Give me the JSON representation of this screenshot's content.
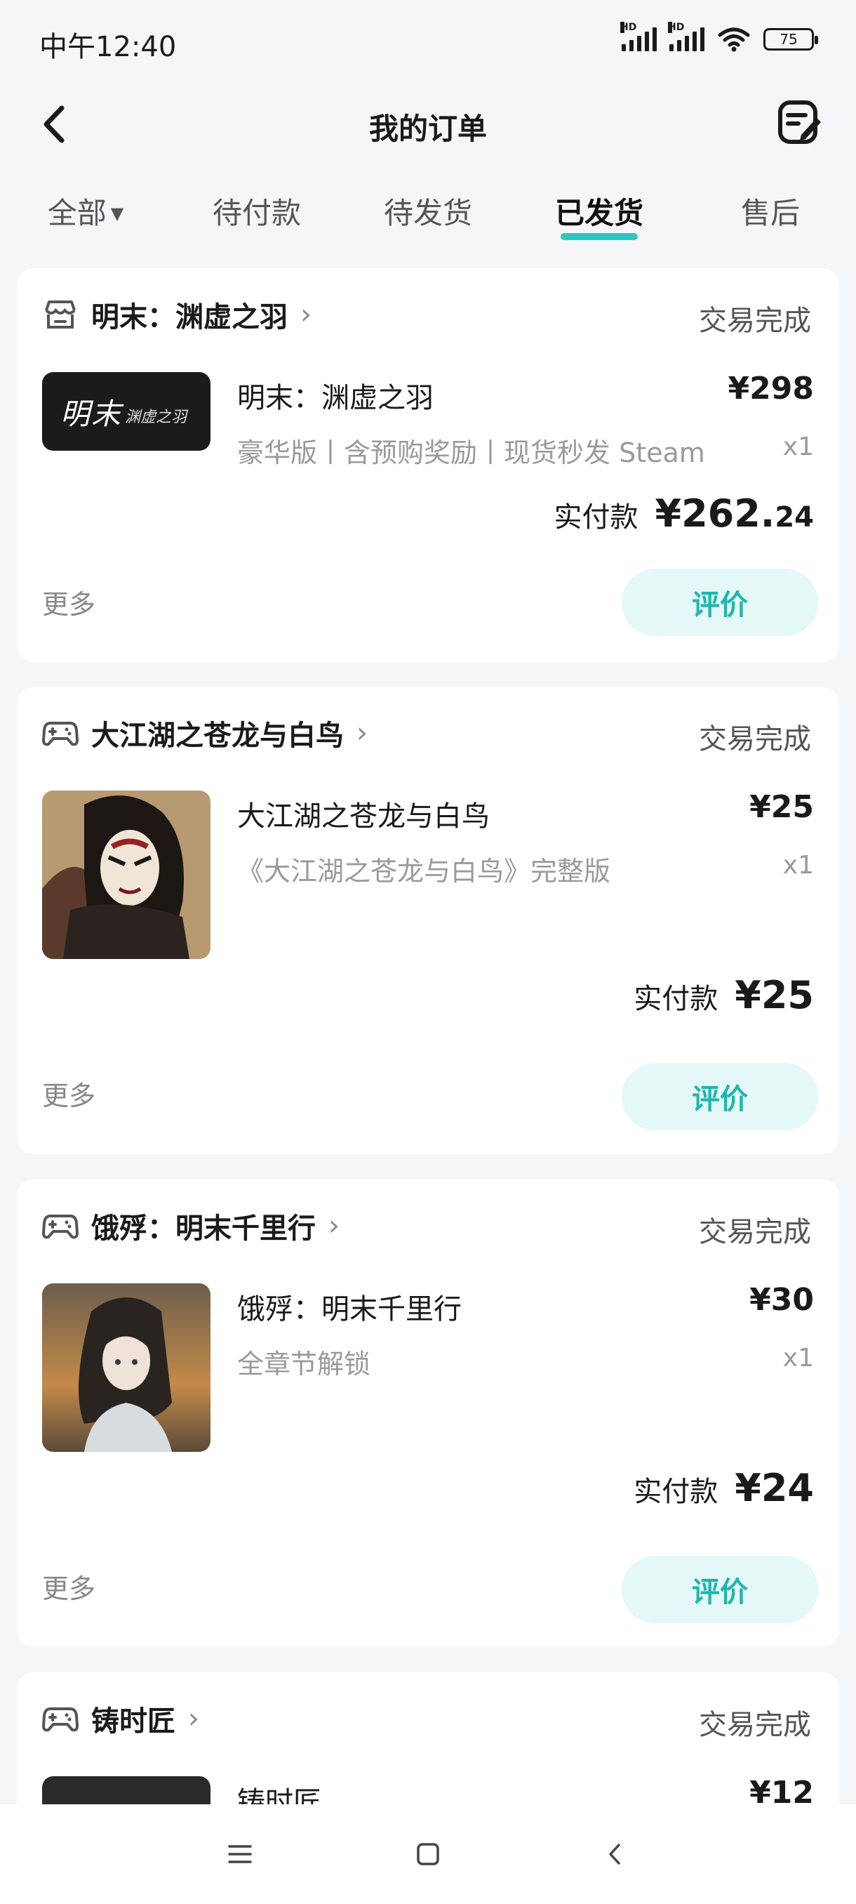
{
  "status_bar": {
    "time": "中午12:40",
    "battery": "75"
  },
  "header": {
    "title": "我的订单"
  },
  "tabs": [
    {
      "label": "全部",
      "has_caret": true
    },
    {
      "label": "待付款"
    },
    {
      "label": "待发货"
    },
    {
      "label": "已发货",
      "active": true
    },
    {
      "label": "售后"
    }
  ],
  "orders": [
    {
      "shop": "明末：渊虚之羽",
      "status": "交易完成",
      "product": "明末：渊虚之羽",
      "price": "¥298",
      "spec": "豪华版丨含预购奖励丨现货秒发 Steam",
      "qty": "x1",
      "paid_label": "实付款",
      "paid_main": "¥262.",
      "paid_decimal": "24",
      "more": "更多",
      "action": "评价"
    },
    {
      "shop": "大江湖之苍龙与白鸟",
      "status": "交易完成",
      "product": "大江湖之苍龙与白鸟",
      "price": "¥25",
      "spec": "《大江湖之苍龙与白鸟》完整版",
      "qty": "x1",
      "paid_label": "实付款",
      "paid_main": "¥25",
      "more": "更多",
      "action": "评价"
    },
    {
      "shop": "饿殍：明末千里行",
      "status": "交易完成",
      "product": "饿殍：明末千里行",
      "price": "¥30",
      "spec": "全章节解锁",
      "qty": "x1",
      "paid_label": "实付款",
      "paid_main": "¥24",
      "more": "更多",
      "action": "评价"
    },
    {
      "shop": "铸时匠",
      "status": "交易完成",
      "product": "铸时匠",
      "price": "¥12"
    }
  ],
  "colors": {
    "accent": "#2cc8c0",
    "button_bg": "#e3f8f7",
    "button_text": "#20b5ad",
    "page_bg": "#f5f6f8"
  }
}
